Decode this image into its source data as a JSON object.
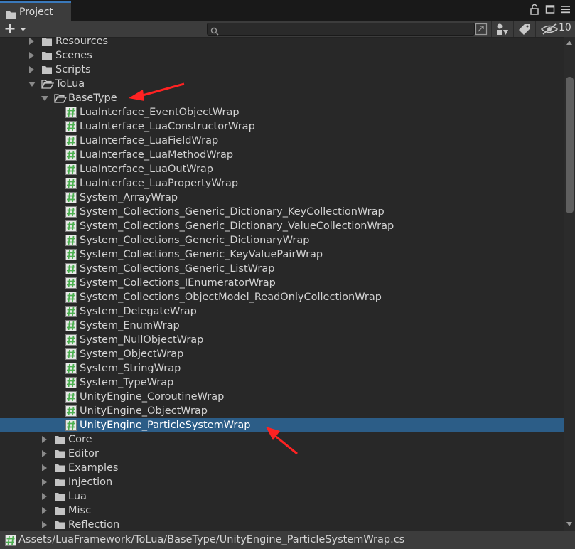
{
  "tab": {
    "title": "Project"
  },
  "toolbar": {
    "create_label": "+",
    "search_value": "",
    "hidden_count": "10"
  },
  "tree": {
    "rows": [
      {
        "label": "Resources",
        "type": "folder",
        "state": "collapsed",
        "depth": 0
      },
      {
        "label": "Scenes",
        "type": "folder",
        "state": "collapsed",
        "depth": 0
      },
      {
        "label": "Scripts",
        "type": "folder",
        "state": "collapsed",
        "depth": 0
      },
      {
        "label": "ToLua",
        "type": "folder",
        "state": "expanded",
        "depth": 0
      },
      {
        "label": "BaseType",
        "type": "folder",
        "state": "expanded",
        "depth": 1
      },
      {
        "label": "LuaInterface_EventObjectWrap",
        "type": "script",
        "depth": 2
      },
      {
        "label": "LuaInterface_LuaConstructorWrap",
        "type": "script",
        "depth": 2
      },
      {
        "label": "LuaInterface_LuaFieldWrap",
        "type": "script",
        "depth": 2
      },
      {
        "label": "LuaInterface_LuaMethodWrap",
        "type": "script",
        "depth": 2
      },
      {
        "label": "LuaInterface_LuaOutWrap",
        "type": "script",
        "depth": 2
      },
      {
        "label": "LuaInterface_LuaPropertyWrap",
        "type": "script",
        "depth": 2
      },
      {
        "label": "System_ArrayWrap",
        "type": "script",
        "depth": 2
      },
      {
        "label": "System_Collections_Generic_Dictionary_KeyCollectionWrap",
        "type": "script",
        "depth": 2
      },
      {
        "label": "System_Collections_Generic_Dictionary_ValueCollectionWrap",
        "type": "script",
        "depth": 2
      },
      {
        "label": "System_Collections_Generic_DictionaryWrap",
        "type": "script",
        "depth": 2
      },
      {
        "label": "System_Collections_Generic_KeyValuePairWrap",
        "type": "script",
        "depth": 2
      },
      {
        "label": "System_Collections_Generic_ListWrap",
        "type": "script",
        "depth": 2
      },
      {
        "label": "System_Collections_IEnumeratorWrap",
        "type": "script",
        "depth": 2
      },
      {
        "label": "System_Collections_ObjectModel_ReadOnlyCollectionWrap",
        "type": "script",
        "depth": 2
      },
      {
        "label": "System_DelegateWrap",
        "type": "script",
        "depth": 2
      },
      {
        "label": "System_EnumWrap",
        "type": "script",
        "depth": 2
      },
      {
        "label": "System_NullObjectWrap",
        "type": "script",
        "depth": 2
      },
      {
        "label": "System_ObjectWrap",
        "type": "script",
        "depth": 2
      },
      {
        "label": "System_StringWrap",
        "type": "script",
        "depth": 2
      },
      {
        "label": "System_TypeWrap",
        "type": "script",
        "depth": 2
      },
      {
        "label": "UnityEngine_CoroutineWrap",
        "type": "script",
        "depth": 2
      },
      {
        "label": "UnityEngine_ObjectWrap",
        "type": "script",
        "depth": 2
      },
      {
        "label": "UnityEngine_ParticleSystemWrap",
        "type": "script",
        "depth": 2,
        "selected": true
      },
      {
        "label": "Core",
        "type": "folder",
        "state": "collapsed",
        "depth": 1
      },
      {
        "label": "Editor",
        "type": "folder",
        "state": "collapsed",
        "depth": 1
      },
      {
        "label": "Examples",
        "type": "folder",
        "state": "collapsed",
        "depth": 1
      },
      {
        "label": "Injection",
        "type": "folder",
        "state": "collapsed",
        "depth": 1
      },
      {
        "label": "Lua",
        "type": "folder",
        "state": "collapsed",
        "depth": 1
      },
      {
        "label": "Misc",
        "type": "folder",
        "state": "collapsed",
        "depth": 1
      },
      {
        "label": "Reflection",
        "type": "folder",
        "state": "collapsed",
        "depth": 1
      }
    ]
  },
  "status": {
    "path": "Assets/LuaFramework/ToLua/BaseType/UnityEngine_ParticleSystemWrap.cs"
  },
  "colors": {
    "accent": "#3a79bb",
    "selection": "#2c5d87",
    "annotation_arrow": "#ff2222",
    "script_icon": "#4caf50"
  }
}
